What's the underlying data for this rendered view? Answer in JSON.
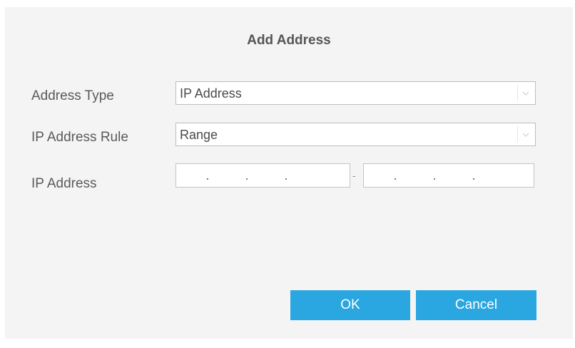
{
  "dialog": {
    "title": "Add Address",
    "ok_label": "OK",
    "cancel_label": "Cancel"
  },
  "form": {
    "address_type": {
      "label": "Address Type",
      "value": "IP Address"
    },
    "ip_address_rule": {
      "label": "IP Address Rule",
      "value": "Range"
    },
    "ip_address": {
      "label": "IP Address",
      "separator": "-"
    }
  },
  "colors": {
    "button": "#2aa6e0",
    "dialog_bg": "#f4f4f4"
  }
}
